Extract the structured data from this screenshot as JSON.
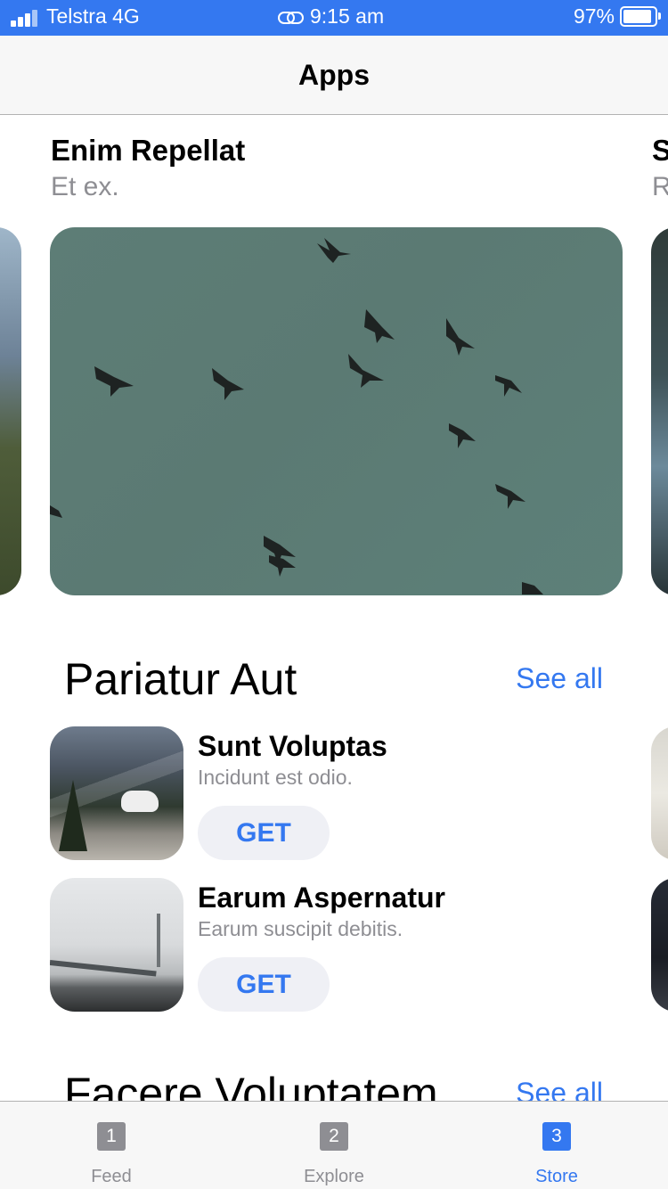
{
  "status_bar": {
    "carrier": "Telstra 4G",
    "time": "9:15 am",
    "battery": "97%",
    "battery_level": 0.97
  },
  "nav": {
    "title": "Apps"
  },
  "featured": {
    "title": "Enim Repellat",
    "subtitle": "Et ex.",
    "next_title_peek": "S",
    "next_subtitle_peek": "R"
  },
  "section1": {
    "title": "Pariatur Aut",
    "see_all": "See all",
    "apps": [
      {
        "name": "Sunt Voluptas",
        "description": "Incidunt est odio.",
        "button": "GET"
      },
      {
        "name": "Earum Aspernatur",
        "description": "Earum suscipit debitis.",
        "button": "GET"
      }
    ]
  },
  "section2": {
    "title": "Facere Voluptatem",
    "see_all": "See all"
  },
  "tab_bar": {
    "tabs": [
      {
        "badge": "1",
        "label": "Feed"
      },
      {
        "badge": "2",
        "label": "Explore"
      },
      {
        "badge": "3",
        "label": "Store",
        "active": true
      }
    ]
  },
  "colors": {
    "accent": "#3478f0",
    "status_bar": "#3478f0",
    "inactive": "#8e8e93"
  }
}
